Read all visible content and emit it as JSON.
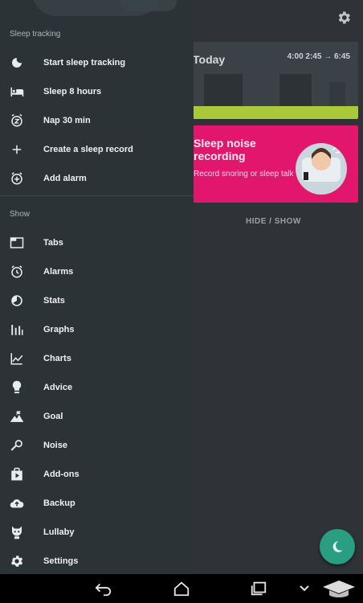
{
  "drawer": {
    "sections": [
      {
        "label": "Sleep tracking",
        "items": [
          {
            "label": "Start sleep tracking",
            "icon": "moon-icon"
          },
          {
            "label": "Sleep 8 hours",
            "icon": "bed-icon"
          },
          {
            "label": "Nap 30 min",
            "icon": "snooze-icon"
          },
          {
            "label": "Create a sleep record",
            "icon": "plus-icon"
          },
          {
            "label": "Add alarm",
            "icon": "add-alarm-icon"
          }
        ]
      },
      {
        "label": "Show",
        "items": [
          {
            "label": "Tabs",
            "icon": "tabs-icon"
          },
          {
            "label": "Alarms",
            "icon": "alarm-clock-icon"
          },
          {
            "label": "Stats",
            "icon": "stats-pie-icon"
          },
          {
            "label": "Graphs",
            "icon": "bar-graph-icon"
          },
          {
            "label": "Charts",
            "icon": "line-chart-icon"
          },
          {
            "label": "Advice",
            "icon": "lightbulb-icon"
          },
          {
            "label": "Goal",
            "icon": "mountain-flag-icon"
          },
          {
            "label": "Noise",
            "icon": "microphone-icon"
          },
          {
            "label": "Add-ons",
            "icon": "shop-bag-icon"
          },
          {
            "label": "Backup",
            "icon": "cloud-upload-icon"
          },
          {
            "label": "Lullaby",
            "icon": "lullaby-icon"
          },
          {
            "label": "Settings",
            "icon": "gear-icon"
          }
        ]
      }
    ]
  },
  "main": {
    "today_card": {
      "title": "Today",
      "times": "4:00 2:45 → 6:45"
    },
    "noise_card": {
      "title": "Sleep noise recording",
      "subtitle": "Record snoring or sleep talk"
    },
    "hide_show": "HIDE / SHOW"
  },
  "colors": {
    "drawer_bg": "#2c3337",
    "accent_fab": "#2a9e80",
    "noise_card": "#e3166e",
    "graph_strip": "#a9c93a"
  }
}
